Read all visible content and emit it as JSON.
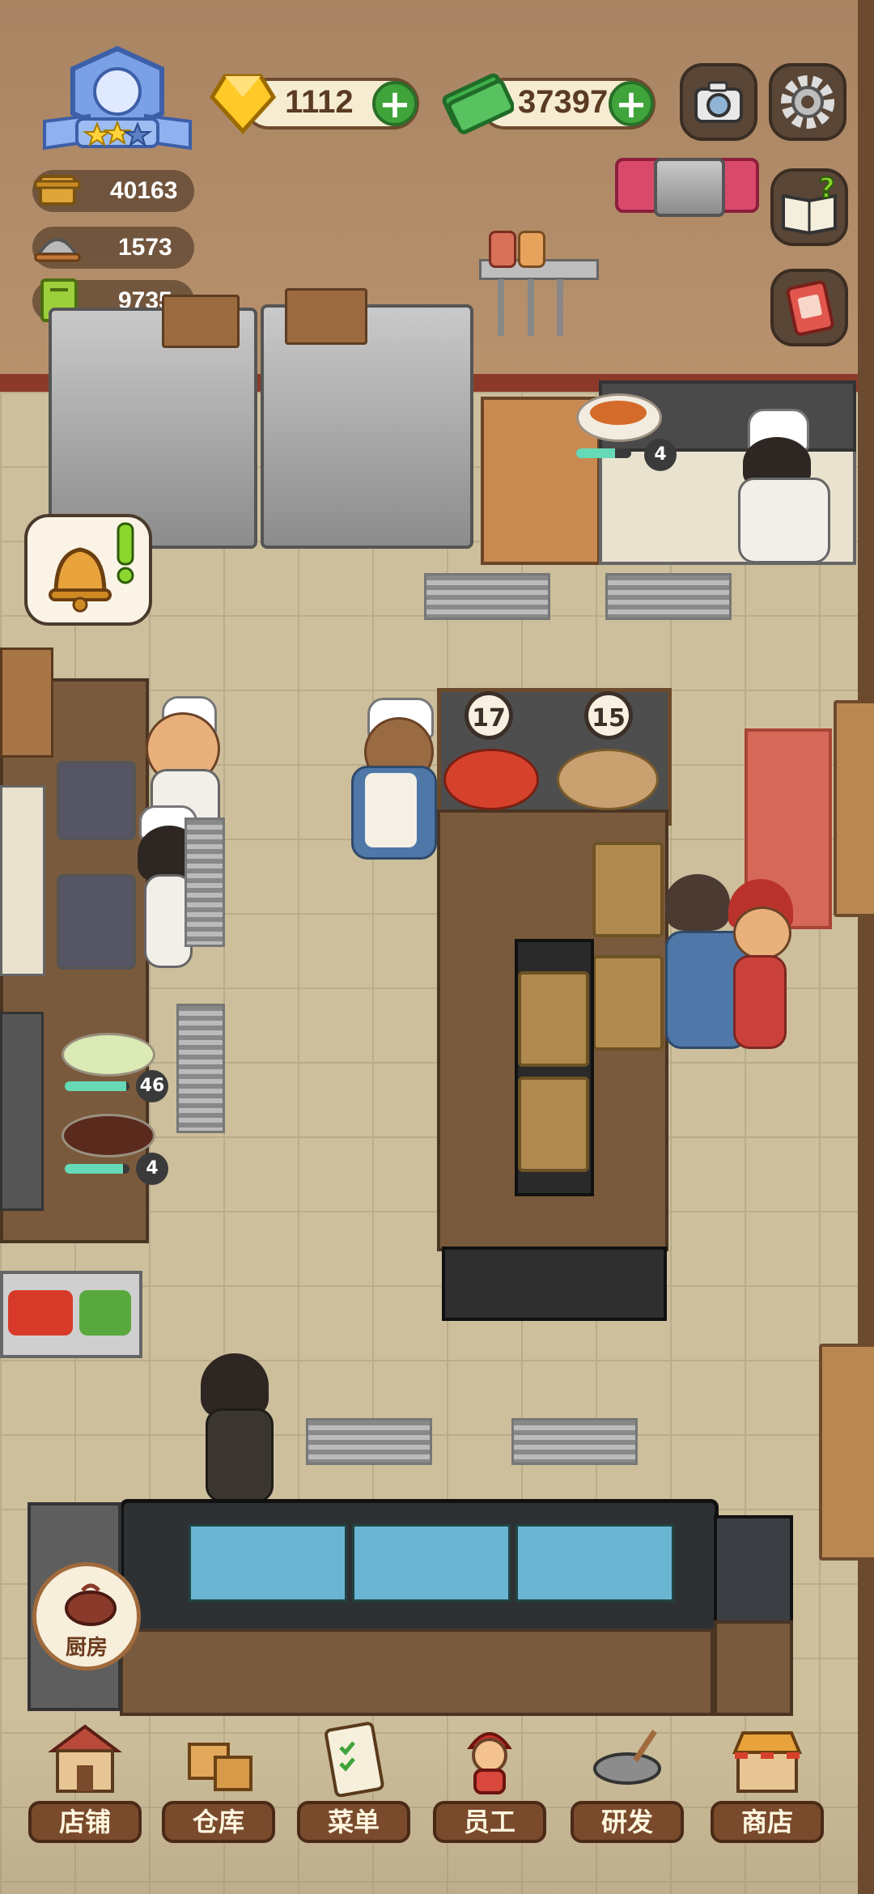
{
  "hud": {
    "gems": "1112",
    "cash": "373971",
    "stats": [
      {
        "icon": "pot-icon",
        "value": "40163"
      },
      {
        "icon": "serving-cloche-icon",
        "value": "1573"
      },
      {
        "icon": "recipe-book-icon",
        "value": "9735"
      }
    ],
    "restaurant_stars": 2,
    "restaurant_stars_max": 3
  },
  "kitchen": {
    "stove_dish_count": "4",
    "stove_progress": 0.7,
    "pass_timers": [
      "17",
      "15"
    ],
    "prep_counts": [
      {
        "count": "46",
        "progress": 0.95
      },
      {
        "count": "4",
        "progress": 0.9
      }
    ],
    "kitchen_button_label": "厨房"
  },
  "colors": {
    "accent_green": "#3fa43a",
    "wall": "#a98463",
    "floor": "#cdbf9c",
    "nav_label": "#7a4a2c"
  },
  "nav": [
    {
      "name": "store",
      "label": "店铺",
      "icon": "storefront-icon"
    },
    {
      "name": "warehouse",
      "label": "仓库",
      "icon": "boxes-icon"
    },
    {
      "name": "menu",
      "label": "菜单",
      "icon": "clipboard-icon"
    },
    {
      "name": "staff",
      "label": "员工",
      "icon": "staff-girl-icon"
    },
    {
      "name": "research",
      "label": "研发",
      "icon": "wok-icon"
    },
    {
      "name": "shop",
      "label": "商店",
      "icon": "shop-stall-icon"
    }
  ]
}
